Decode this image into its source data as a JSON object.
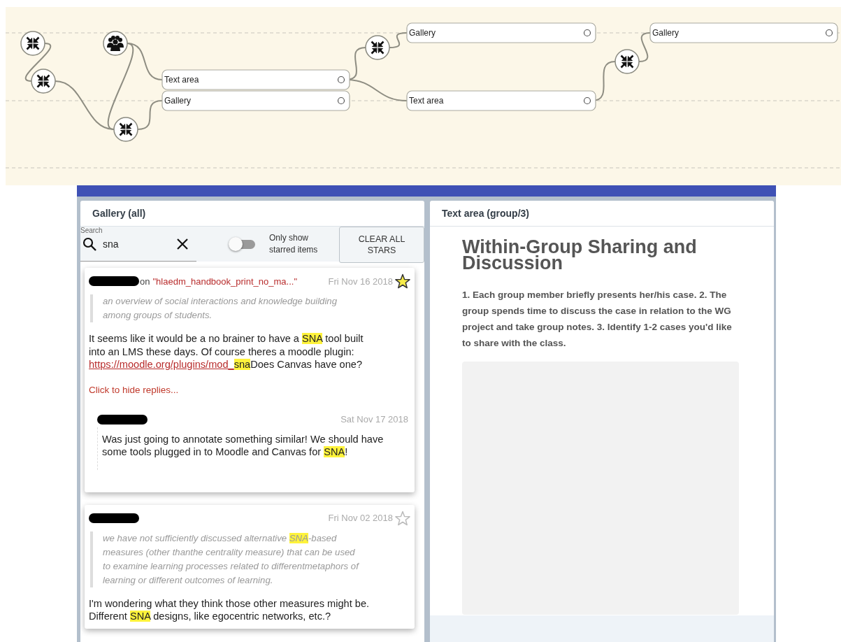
{
  "diagram": {
    "nodes": [
      {
        "kind": "merge"
      },
      {
        "kind": "merge"
      },
      {
        "kind": "group"
      },
      {
        "kind": "merge"
      },
      {
        "kind": "block",
        "label": "Text area"
      },
      {
        "kind": "block",
        "label": "Gallery"
      },
      {
        "kind": "merge"
      },
      {
        "kind": "block",
        "label": "Gallery"
      },
      {
        "kind": "block",
        "label": "Text area"
      },
      {
        "kind": "merge"
      },
      {
        "kind": "block",
        "label": "Gallery"
      }
    ]
  },
  "gallery": {
    "title": "Gallery (all)",
    "search": {
      "label": "Search",
      "value": "sna"
    },
    "starred_filter": {
      "label": "Only show starred items",
      "on": false
    },
    "clear_button": "CLEAR ALL STARS",
    "cards": [
      {
        "target_prefix": "on",
        "target": "\"hlaedm_handbook_print_no_ma...\"",
        "date": "Fri Nov 16 2018",
        "starred": true,
        "quote": [
          {
            "kind": "text",
            "text": "an overview of social interactions and knowledge building among groups of students."
          }
        ],
        "body": [
          {
            "kind": "text",
            "text": "It seems like it would be a no brainer to have a "
          },
          {
            "kind": "highlight",
            "text": "SNA"
          },
          {
            "kind": "text",
            "text": " tool built into an LMS these days. Of course theres a moodle plugin: "
          },
          {
            "kind": "link",
            "text": "https://moodle.org/plugins/mod_"
          },
          {
            "kind": "highlight",
            "text": "sna"
          },
          {
            "kind": "text",
            "text": "Does Canvas have one?"
          }
        ],
        "replies_toggle": "Click to hide replies...",
        "replies": [
          {
            "date": "Sat Nov 17 2018",
            "body": [
              {
                "kind": "text",
                "text": "Was just going to annotate something similar! We should have some tools plugged in to Moodle and Canvas for "
              },
              {
                "kind": "highlight",
                "text": "SNA"
              },
              {
                "kind": "text",
                "text": "!"
              }
            ]
          }
        ]
      },
      {
        "date": "Fri Nov 02 2018",
        "starred": false,
        "quote": [
          {
            "kind": "text",
            "text": "we have not sufficiently discussed alternative "
          },
          {
            "kind": "highlight",
            "text": "SNA"
          },
          {
            "kind": "text",
            "text": "-based measures (other thanthe centrality measure) that can be used to examine learning processes related to differentmetaphors of learning or different outcomes of learning."
          }
        ],
        "body": [
          {
            "kind": "text",
            "text": "I'm wondering what they think those other measures might be. Different "
          },
          {
            "kind": "highlight",
            "text": "SNA"
          },
          {
            "kind": "text",
            "text": " designs, like egocentric networks, etc.?"
          }
        ]
      }
    ]
  },
  "text_area": {
    "title": "Text area (group/3)",
    "heading": "Within-Group Sharing and Discussion",
    "instructions": "1. Each group member briefly presents her/his case. 2. The group spends time to discuss the case in relation to the WG project and take group notes. 3. Identify 1-2 cases you'd like to share with the class."
  }
}
